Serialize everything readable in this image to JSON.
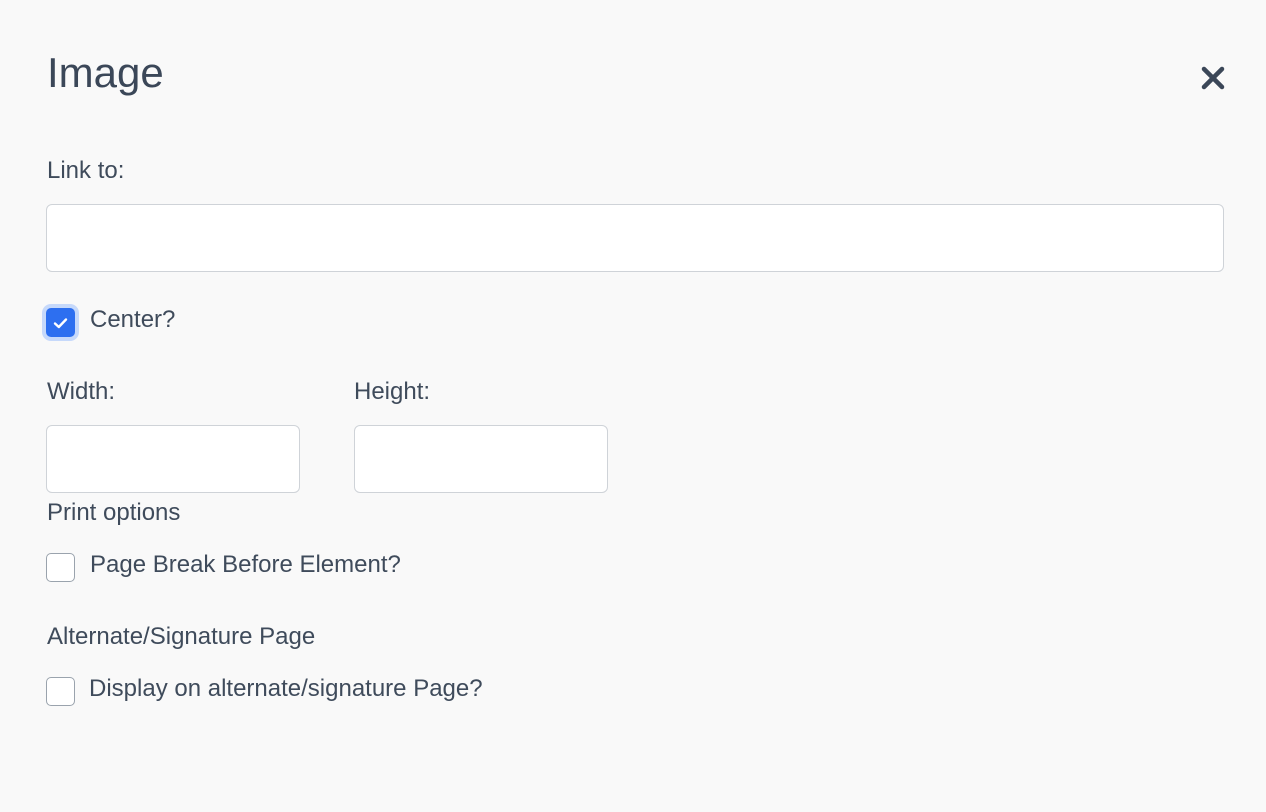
{
  "dialog": {
    "title": "Image",
    "close_icon": "close-icon"
  },
  "link": {
    "label": "Link to:",
    "value": "",
    "placeholder": ""
  },
  "center": {
    "label": "Center?",
    "checked": true,
    "check_icon": "checkmark-icon"
  },
  "size": {
    "width_label": "Width:",
    "width_value": "",
    "height_label": "Height:",
    "height_value": ""
  },
  "print_options": {
    "heading": "Print options",
    "page_break_label": "Page Break Before Element?",
    "page_break_checked": false
  },
  "alternate_page": {
    "heading": "Alternate/Signature Page",
    "display_label": "Display on alternate/signature Page?",
    "display_checked": false
  },
  "colors": {
    "accent": "#2d6ff0",
    "text": "#3f4b5b",
    "background": "#f9f9f9"
  }
}
